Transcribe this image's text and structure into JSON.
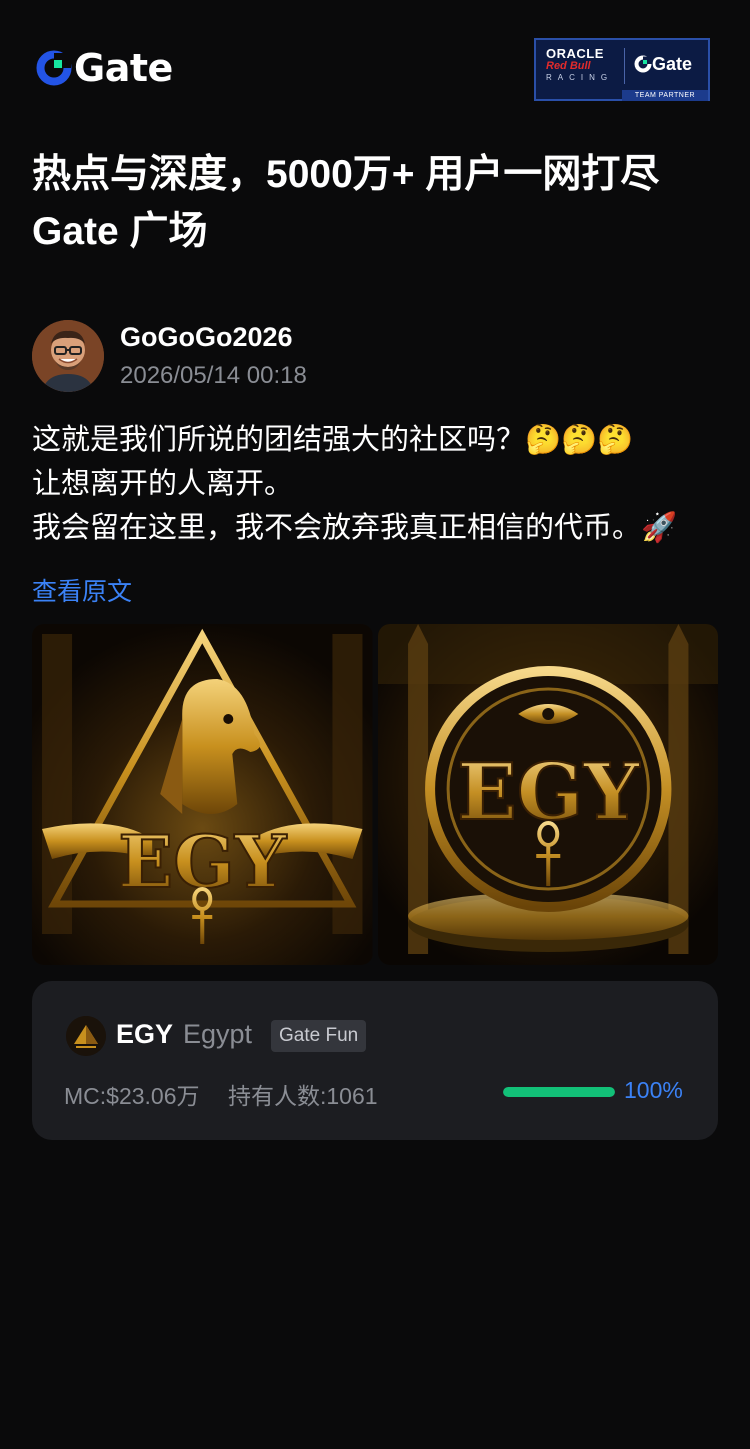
{
  "header": {
    "logo_text": "Gate",
    "partner": {
      "oracle": "ORACLE",
      "redbull": "Red Bull",
      "racing": "RACING",
      "gate": "Gate",
      "team_partner": "TEAM PARTNER"
    }
  },
  "headline": {
    "line1": "热点与深度，5000万+ 用户一网打尽",
    "line2": "Gate 广场"
  },
  "post": {
    "author": "GoGoGo2026",
    "timestamp": "2026/05/14 00:18",
    "lines": [
      "这就是我们所说的团结强大的社区吗？🤔🤔🤔",
      "让想离开的人离开。",
      "我会留在这里，我不会放弃我真正相信的代币。🚀"
    ],
    "view_original": "查看原文",
    "image_texts": [
      "EGY",
      "EGY"
    ]
  },
  "token": {
    "symbol": "EGY",
    "name": "Egypt",
    "tag": "Gate Fun",
    "market_cap": "MC:$23.06万",
    "holders": "持有人数:1061",
    "progress_percent": 100,
    "progress_label": "100%"
  },
  "colors": {
    "background": "#0a0a0b",
    "accent_blue": "#3b82f6",
    "progress_green": "#12c078",
    "card_bg": "#1c1d21"
  }
}
